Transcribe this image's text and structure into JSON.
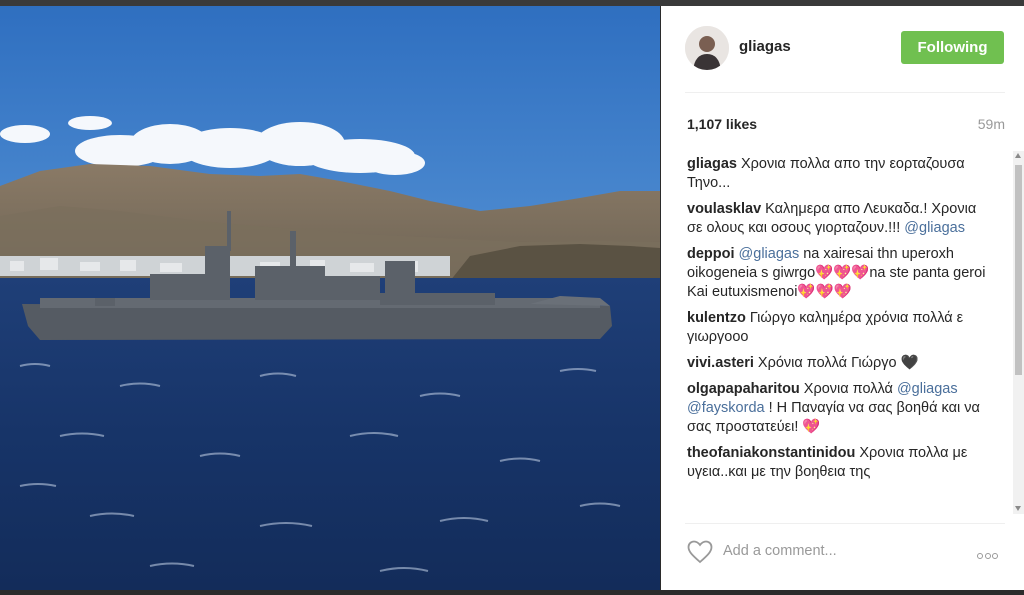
{
  "post": {
    "username": "gliagas",
    "follow_label": "Following",
    "likes": "1,107 likes",
    "time": "59m"
  },
  "comments": [
    {
      "user": "gliagas",
      "text": "Χρονια πολλα απο την εορταζουσα Τηνο..."
    },
    {
      "user": "voulasklav",
      "text": "Καλημερα απο Λευκαδα.! Χρονια σε ολους και οσους γιορταζουν.!!! ",
      "mention": "@gliagas"
    },
    {
      "user": "deppoi",
      "mention": "@gliagas",
      "text": " na xairesai thn uperoxh oikogeneia s giwrgo💖💖💖na ste panta geroi Kai eutuxismenoi💖💖💖"
    },
    {
      "user": "kulentzo",
      "text": "Γιώργο καλημέρα χρόνια πολλά ε γιωργοοο"
    },
    {
      "user": "vivi.asteri",
      "text": "Χρόνια πολλά Γιώργο 🖤"
    },
    {
      "user": "olgapapaharitou",
      "text": "Χρονια πολλά ",
      "mentions": "@gliagas @fayskorda",
      "text2": " ! Η Παναγία να σας βοηθά και να σας προστατεύει! 💖"
    },
    {
      "user": "theofaniakonstantinidou",
      "text": "Χρονια πολλα με υγεια..και με την βοηθεια της"
    }
  ],
  "footer": {
    "placeholder": "Add a comment..."
  },
  "icons": {
    "like": "heart-icon",
    "more": "more-options-icon"
  },
  "colors": {
    "follow_button": "#70c050",
    "mention": "#4a6f9b"
  }
}
